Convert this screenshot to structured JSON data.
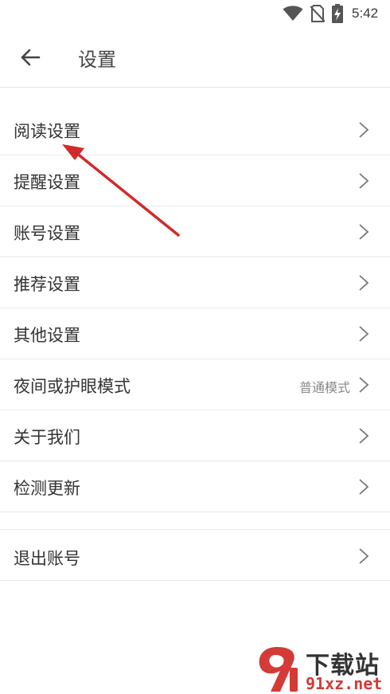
{
  "status_bar": {
    "time": "5:42",
    "icons": [
      "wifi-icon",
      "no-sim-icon",
      "battery-charging-icon"
    ]
  },
  "header": {
    "title": "设置",
    "back_icon": "arrow-left-icon"
  },
  "menu": {
    "items": [
      {
        "label": "阅读设置"
      },
      {
        "label": "提醒设置"
      },
      {
        "label": "账号设置"
      },
      {
        "label": "推荐设置"
      },
      {
        "label": "其他设置"
      },
      {
        "label": "夜间或护眼模式",
        "value": "普通模式"
      },
      {
        "label": "关于我们"
      },
      {
        "label": "检测更新"
      }
    ],
    "logout": {
      "label": "退出账号"
    },
    "chevron_icon": "chevron-right-icon"
  },
  "annotation": {
    "type": "red-arrow",
    "color": "#d22a2a",
    "points_to": "阅读设置"
  },
  "watermark": {
    "logo_text": "9",
    "title": "下载站",
    "url": "91xz.net",
    "accent_color": "#d43a36"
  }
}
